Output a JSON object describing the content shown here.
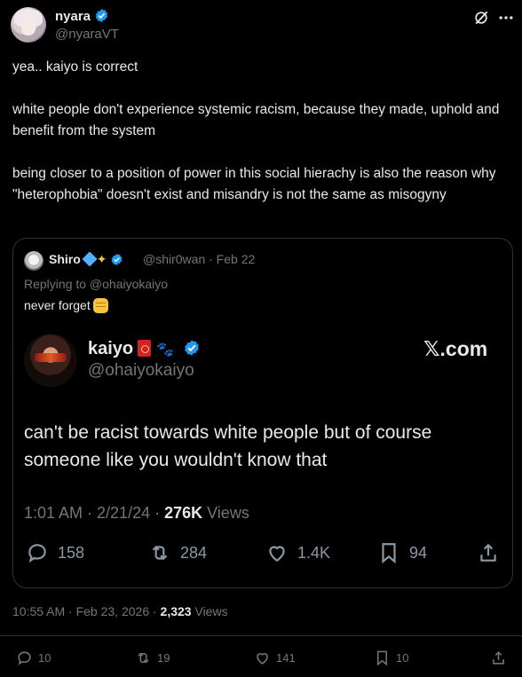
{
  "post": {
    "display_name": "nyara",
    "handle": "@nyaraVT",
    "paragraphs": [
      "yea.. kaiyo is correct",
      "white people don't experience systemic racism, because they made, uphold and benefit from the system",
      "being closer to a position of power in this social hierachy is also the reason why \"heterophobia\" doesn't exist and misandry is not the same as misogyny"
    ],
    "timestamp": "10:55 AM · Feb 23, 2026 · ",
    "views_count": "2,323",
    "views_label": " Views"
  },
  "quote": {
    "display_name": "Shiro",
    "handle_date": "@shir0wan · Feb 22",
    "replying_to": "Replying to @ohaiyokaiyo",
    "text": "never forget"
  },
  "embedded": {
    "display_name": "kaiyo",
    "handle": "@ohaiyokaiyo",
    "brand": "𝕏.com",
    "text": "can't be racist towards white people but of course someone like you wouldn't know that",
    "meta_time": "1:01 AM · 2/21/24 · ",
    "meta_views": "276K",
    "meta_views_label": " Views",
    "actions": {
      "replies": "158",
      "reposts": "284",
      "likes": "1.4K",
      "bookmarks": "94"
    }
  },
  "actions": {
    "replies": "10",
    "reposts": "19",
    "likes": "141",
    "bookmarks": "10"
  },
  "colors": {
    "background": "#000000",
    "text": "#e7e9ea",
    "muted": "#71767b",
    "verified": "#1d9bf0",
    "border": "#2f3336"
  }
}
